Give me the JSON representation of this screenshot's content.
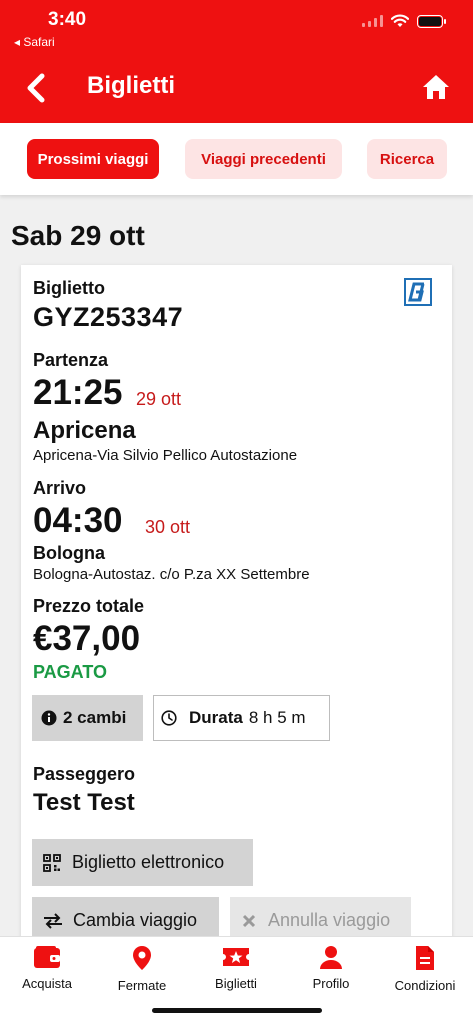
{
  "status": {
    "time": "3:40",
    "back_app": "◂ Safari"
  },
  "nav": {
    "title": "Biglietti",
    "back_icon": "chevron-left-icon",
    "home_icon": "home-icon"
  },
  "tabs": [
    {
      "label": "Prossimi viaggi",
      "active": true
    },
    {
      "label": "Viaggi precedenti",
      "active": false
    },
    {
      "label": "Ricerca",
      "active": false
    }
  ],
  "date_header": "Sab 29 ott",
  "ticket": {
    "ticket_label": "Biglietto",
    "ticket_code": "GYZ253347",
    "operator_icon": "operator-logo-icon",
    "departure": {
      "label": "Partenza",
      "time": "21:25",
      "date": "29 ott",
      "city": "Apricena",
      "stop": "Apricena-Via Silvio Pellico Autostazione"
    },
    "arrival": {
      "label": "Arrivo",
      "time": "04:30",
      "date": "30 ott",
      "city": "Bologna",
      "stop": "Bologna-Autostaz. c/o P.za XX Settembre"
    },
    "price_label": "Prezzo totale",
    "price": "€37,00",
    "payment_status": "PAGATO",
    "changes": "2 cambi",
    "duration_label": "Durata",
    "duration_value": "8 h 5 m",
    "passenger_label": "Passeggero",
    "passenger_name": "Test Test",
    "actions": {
      "eticket": "Biglietto elettronico",
      "change": "Cambia viaggio",
      "cancel": "Annulla viaggio"
    }
  },
  "bottom_tabs": [
    {
      "label": "Acquista",
      "icon": "wallet-icon"
    },
    {
      "label": "Fermate",
      "icon": "map-pin-icon"
    },
    {
      "label": "Biglietti",
      "icon": "ticket-icon"
    },
    {
      "label": "Profilo",
      "icon": "user-icon"
    },
    {
      "label": "Condizioni",
      "icon": "document-icon"
    }
  ],
  "colors": {
    "brand_red": "#ee1111",
    "paid_green": "#1a9a44",
    "date_red": "#c61b1b"
  }
}
